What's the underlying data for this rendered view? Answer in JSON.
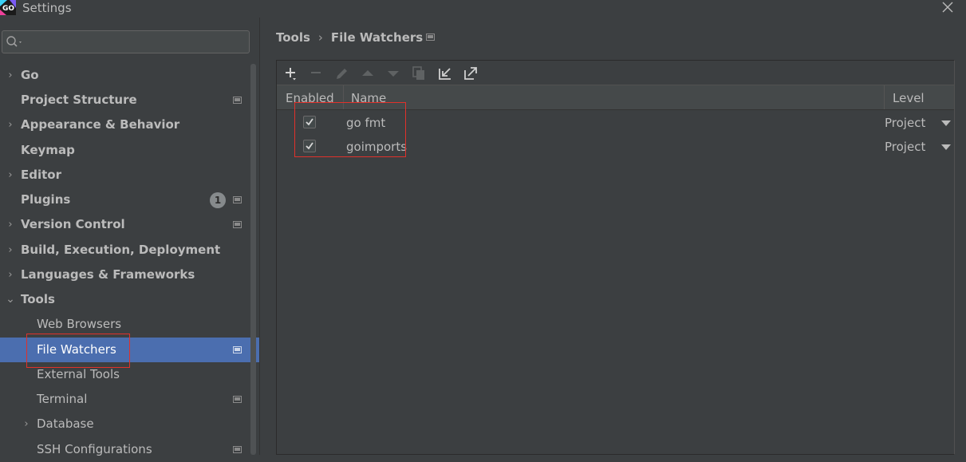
{
  "window": {
    "title": "Settings",
    "app_logo_text": "GO"
  },
  "search": {
    "placeholder": ""
  },
  "sidebar": {
    "items": [
      {
        "label": "Go",
        "chevron": "›",
        "has_settings_icon": false
      },
      {
        "label": "Project Structure",
        "chevron": "",
        "has_settings_icon": true
      },
      {
        "label": "Appearance & Behavior",
        "chevron": "›",
        "has_settings_icon": false
      },
      {
        "label": "Keymap",
        "chevron": "",
        "has_settings_icon": false
      },
      {
        "label": "Editor",
        "chevron": "›",
        "has_settings_icon": false
      },
      {
        "label": "Plugins",
        "chevron": "",
        "has_settings_icon": true,
        "badge": "1"
      },
      {
        "label": "Version Control",
        "chevron": "›",
        "has_settings_icon": true
      },
      {
        "label": "Build, Execution, Deployment",
        "chevron": "›",
        "has_settings_icon": false
      },
      {
        "label": "Languages & Frameworks",
        "chevron": "›",
        "has_settings_icon": false
      },
      {
        "label": "Tools",
        "chevron": "⌄",
        "has_settings_icon": false
      },
      {
        "label": "Web Browsers",
        "has_settings_icon": false
      },
      {
        "label": "File Watchers",
        "has_settings_icon": true,
        "selected": true
      },
      {
        "label": "External Tools",
        "has_settings_icon": false
      },
      {
        "label": "Terminal",
        "has_settings_icon": true
      },
      {
        "label": "Database",
        "chevron": "›",
        "has_settings_icon": false
      },
      {
        "label": "SSH Configurations",
        "has_settings_icon": true
      }
    ]
  },
  "breadcrumb": {
    "parent": "Tools",
    "separator": "›",
    "current": "File Watchers"
  },
  "toolbar": {
    "buttons": [
      "add-icon",
      "remove-icon",
      "edit-icon",
      "move-up-icon",
      "move-down-icon",
      "copy-icon",
      "import-icon",
      "export-icon"
    ]
  },
  "table": {
    "columns": {
      "enabled": "Enabled",
      "name": "Name",
      "level": "Level"
    },
    "rows": [
      {
        "enabled": true,
        "name": "go fmt",
        "level": "Project"
      },
      {
        "enabled": true,
        "name": "goimports",
        "level": "Project"
      }
    ]
  },
  "colors": {
    "background": "#3c3f41",
    "selection": "#4b6eaf",
    "highlight_box": "#e0312b"
  }
}
